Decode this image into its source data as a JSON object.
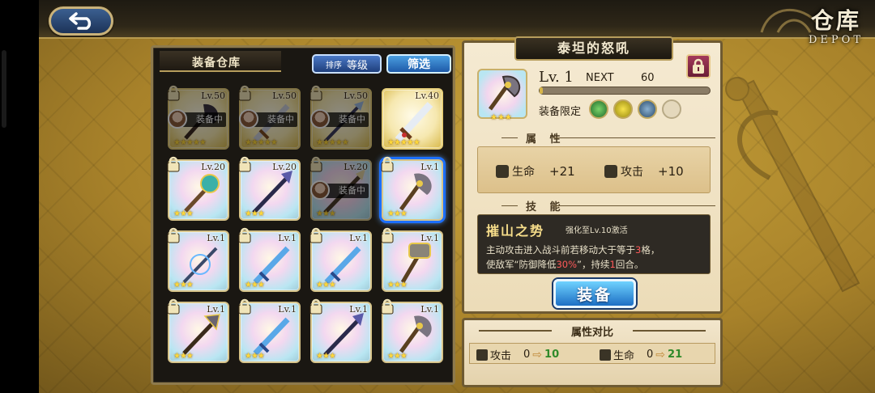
{
  "header": {
    "title_cn": "仓库",
    "title_en": "DEPOT"
  },
  "inventory": {
    "title": "装备仓库",
    "sort_prefix": "排序",
    "sort_value": "等级",
    "filter_label": "筛选",
    "items": [
      {
        "level": "Lv.50",
        "equipped_label": "装备中",
        "locked": true,
        "equipped": true,
        "weapon": "dark-axe",
        "stars": "★★★★★",
        "rarity": "gold"
      },
      {
        "level": "Lv.50",
        "equipped_label": "装备中",
        "locked": true,
        "equipped": true,
        "weapon": "silver-sword",
        "stars": "★★★★★",
        "rarity": "gold"
      },
      {
        "level": "Lv.50",
        "equipped_label": "装备中",
        "locked": true,
        "equipped": true,
        "weapon": "spear",
        "stars": "★★★★★",
        "rarity": "gold"
      },
      {
        "level": "Lv.40",
        "locked": false,
        "equipped": false,
        "weapon": "great-sword",
        "stars": "★★★★★",
        "rarity": "gold"
      },
      {
        "level": "Lv.20",
        "locked": true,
        "equipped": false,
        "weapon": "mace",
        "stars": "★★★",
        "rarity": "normal"
      },
      {
        "level": "Lv.20",
        "locked": true,
        "equipped": false,
        "weapon": "dark-spear",
        "stars": "★★★",
        "rarity": "normal"
      },
      {
        "level": "Lv.20",
        "equipped_label": "装备中",
        "locked": true,
        "equipped": true,
        "weapon": "lance",
        "stars": "★★★",
        "rarity": "normal"
      },
      {
        "level": "Lv.1",
        "locked": true,
        "equipped": false,
        "weapon": "axe",
        "stars": "★★★",
        "rarity": "normal",
        "selected": true
      },
      {
        "level": "Lv.1",
        "locked": true,
        "equipped": false,
        "weapon": "staff",
        "stars": "★★★",
        "rarity": "normal"
      },
      {
        "level": "Lv.1",
        "locked": true,
        "equipped": false,
        "weapon": "blue-sword",
        "stars": "★★★",
        "rarity": "normal"
      },
      {
        "level": "Lv.1",
        "locked": true,
        "equipped": false,
        "weapon": "blue-sword",
        "stars": "★★★",
        "rarity": "normal"
      },
      {
        "level": "Lv.1",
        "locked": true,
        "equipped": false,
        "weapon": "war-hammer",
        "stars": "★★★",
        "rarity": "normal"
      },
      {
        "level": "Lv.1",
        "locked": true,
        "equipped": false,
        "weapon": "halberd",
        "stars": "★★★",
        "rarity": "normal"
      },
      {
        "level": "Lv.1",
        "locked": true,
        "equipped": false,
        "weapon": "blue-sword",
        "stars": "★★★",
        "rarity": "normal"
      },
      {
        "level": "Lv.1",
        "locked": true,
        "equipped": false,
        "weapon": "dark-spear",
        "stars": "★★★",
        "rarity": "normal"
      },
      {
        "level": "Lv.1",
        "locked": true,
        "equipped": false,
        "weapon": "axe",
        "stars": "★★★",
        "rarity": "normal"
      }
    ]
  },
  "detail": {
    "name": "泰坦的怒吼",
    "level": "Lv. 1",
    "next_label": "NEXT",
    "next_value": "60",
    "exp_fraction": 0.0,
    "limit_label": "装备限定",
    "stars": "★★★",
    "attributes_heading": "属 性",
    "stats": [
      {
        "icon": "heart-icon",
        "label": "生命",
        "value": "+21"
      },
      {
        "icon": "sword-icon",
        "label": "攻击",
        "value": "+10"
      }
    ],
    "skill_heading": "技 能",
    "skill_name": "摧山之势",
    "skill_unlock": "强化至Lv.10激活",
    "skill_desc_1": "主动攻击进入战斗前若移动大于等于",
    "skill_desc_num1": "3",
    "skill_desc_2": "格，",
    "skill_desc_3": "使敌军“防御降低",
    "skill_desc_pct": "30%",
    "skill_desc_4": "”，持续",
    "skill_desc_num2": "1",
    "skill_desc_5": "回合。",
    "equip_label": "装备"
  },
  "compare": {
    "title": "属性对比",
    "rows": [
      {
        "label": "攻击",
        "old": "0",
        "new": "10"
      },
      {
        "label": "生命",
        "old": "0",
        "new": "21"
      }
    ]
  },
  "colors": {
    "gold": "#d7b64a",
    "accent_blue": "#1d6fc4",
    "highlight_red": "#ff5a5a",
    "increase_green": "#2f8a2a"
  }
}
